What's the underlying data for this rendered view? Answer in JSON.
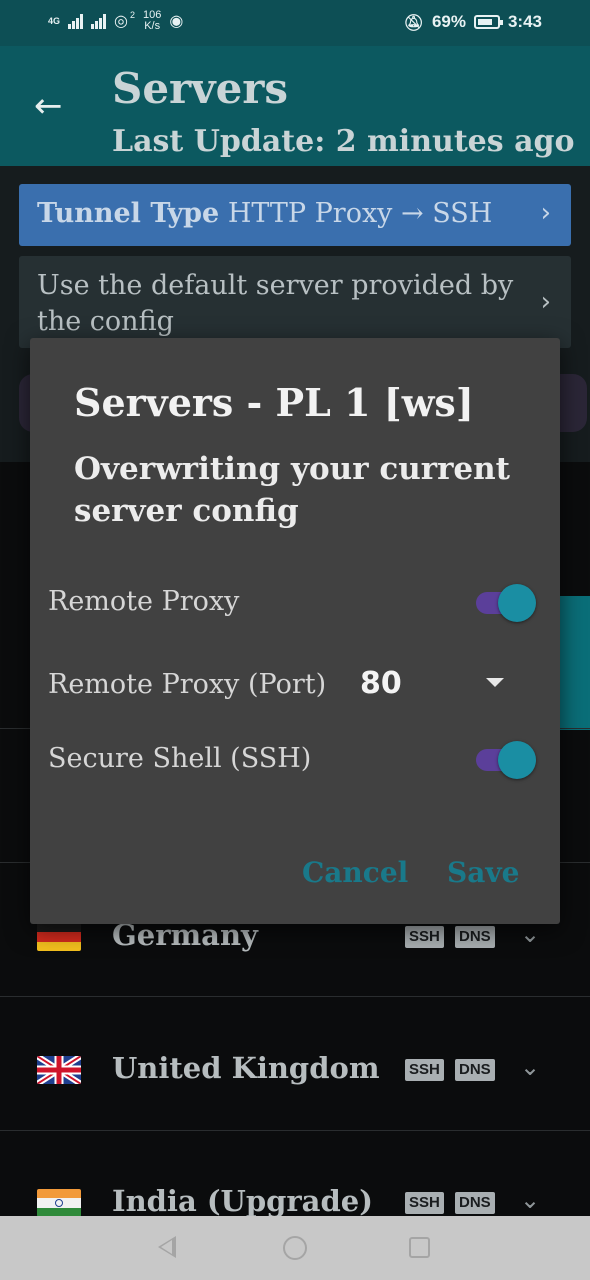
{
  "status_bar": {
    "network_type": "4G",
    "speed_value": "106",
    "speed_unit": "K/s",
    "hotspot_count": "2",
    "battery": "69%",
    "time": "3:43"
  },
  "header": {
    "title": "Servers",
    "subtitle": "Last Update: 2 minutes ago"
  },
  "tunnel": {
    "label": "Tunnel Type",
    "value": "HTTP Proxy → SSH"
  },
  "default_server_text": "Use the default server provided by the config",
  "servers": [
    {
      "name": "Germany",
      "tags": [
        "SSH",
        "DNS"
      ]
    },
    {
      "name": "United Kingdom",
      "tags": [
        "SSH",
        "DNS"
      ]
    },
    {
      "name": "India (Upgrade)",
      "tags": [
        "SSH",
        "DNS"
      ]
    }
  ],
  "dialog": {
    "title": "Servers - PL 1 [ws]",
    "message": "Overwriting your current server config",
    "remote_proxy_label": "Remote Proxy",
    "remote_proxy_enabled": true,
    "remote_proxy_port_label": "Remote Proxy (Port)",
    "remote_proxy_port_value": "80",
    "ssh_label": "Secure Shell (SSH)",
    "ssh_enabled": true,
    "cancel_label": "Cancel",
    "save_label": "Save"
  },
  "colors": {
    "header_bg": "#0c5960",
    "accent": "#19798a",
    "switch_track": "#5b3f9a",
    "tunnel_bg": "#3a6fae"
  }
}
